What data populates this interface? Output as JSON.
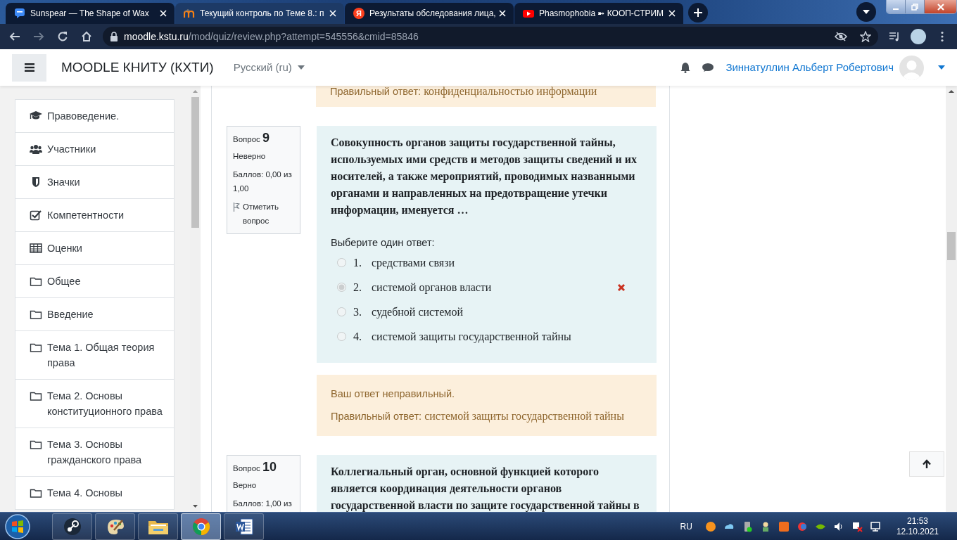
{
  "browser": {
    "tabs": [
      {
        "title": "Sunspear — The Shape of Wax",
        "selected": false,
        "kind": "chat"
      },
      {
        "title": "Текущий контроль по Теме 8.: п",
        "selected": true,
        "kind": "moodle"
      },
      {
        "title": "Результаты обследования лица,",
        "selected": false,
        "kind": "letter",
        "favicon_text": "Я"
      },
      {
        "title": "Phasmophobia ➼ КООП-СТРИМ",
        "selected": false,
        "kind": "video"
      }
    ],
    "url": {
      "host": "moodle.kstu.ru",
      "path": "/mod/quiz/review.php?attempt=545556&cmid=85846"
    }
  },
  "navbar": {
    "brand": "MOODLE КНИТУ (КХТИ)",
    "language": "Русский (ru)",
    "user_name": "Зиннатуллин Альберт Робертович"
  },
  "sidebar": {
    "items": [
      {
        "label": "Правоведение.",
        "kind": "course"
      },
      {
        "label": "Участники",
        "kind": "participants"
      },
      {
        "label": "Значки",
        "kind": "badges"
      },
      {
        "label": "Компетентности",
        "kind": "competencies"
      },
      {
        "label": "Оценки",
        "kind": "grades"
      },
      {
        "label": "Общее",
        "kind": "section"
      },
      {
        "label": "Введение",
        "kind": "section"
      },
      {
        "label": "Тема 1. Общая теория права",
        "kind": "section"
      },
      {
        "label": "Тема 2. Основы конституционного права",
        "kind": "section"
      },
      {
        "label": "Тема 3. Основы гражданского права",
        "kind": "section"
      },
      {
        "label": "Тема 4. Основы",
        "kind": "section"
      }
    ]
  },
  "previous_feedback": {
    "correct_label": "Правильный ответ:",
    "correct_answer": "конфиденциальностью информации"
  },
  "questions": [
    {
      "label": "Вопрос",
      "number": "9",
      "status": "Неверно",
      "grade": "Баллов: 0,00 из 1,00",
      "flag_label": "Отметить вопрос",
      "text": "Совокупность органов защиты государственной тайны, используемых ими средств и методов защиты сведений и их носителей, а также мероприятий, проводимых названными органами и направленных на предотвращение утечки информации, именуется …",
      "prompt": "Выберите один ответ:",
      "answers": [
        {
          "index": "1.",
          "text": "средствами связи",
          "selected": false,
          "incorrect": false
        },
        {
          "index": "2.",
          "text": "системой органов власти",
          "selected": true,
          "incorrect": true
        },
        {
          "index": "3.",
          "text": "судебной системой",
          "selected": false,
          "incorrect": false
        },
        {
          "index": "4.",
          "text": "системой защиты государственной тайны",
          "selected": false,
          "incorrect": false
        }
      ],
      "feedback": {
        "result": "Ваш ответ неправильный.",
        "correct_label": "Правильный ответ:",
        "correct_answer": "системой защиты государственной тайны"
      }
    },
    {
      "label": "Вопрос",
      "number": "10",
      "status": "Верно",
      "grade": "Баллов: 1,00 из",
      "text": "Коллегиальный орган, основной функцией которого является координация деятельности органов государственной власти по защите государственной тайны в"
    }
  ],
  "taskbar": {
    "apps": [
      {
        "kind": "steam",
        "selected": false
      },
      {
        "kind": "paint",
        "selected": false
      },
      {
        "kind": "explorer",
        "selected": false
      },
      {
        "kind": "chrome",
        "selected": true
      },
      {
        "kind": "word",
        "selected": false
      }
    ],
    "language": "RU",
    "time": "21:53",
    "date": "12.10.2021"
  }
}
